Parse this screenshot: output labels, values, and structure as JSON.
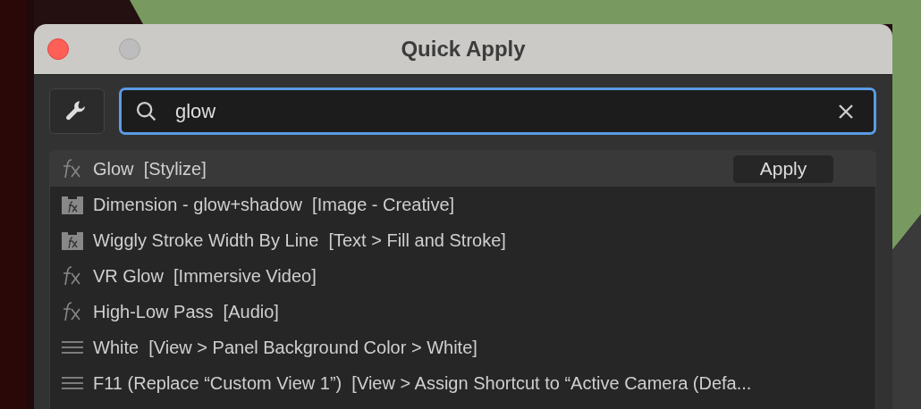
{
  "window": {
    "title": "Quick Apply"
  },
  "search": {
    "value": "glow"
  },
  "results": [
    {
      "kind": "effect",
      "label": "Glow  [Stylize]",
      "selected": true,
      "action": "Apply"
    },
    {
      "kind": "preset",
      "label": "Dimension - glow+shadow  [Image - Creative]",
      "selected": false
    },
    {
      "kind": "preset",
      "label": "Wiggly Stroke Width By Line  [Text > Fill and Stroke]",
      "selected": false
    },
    {
      "kind": "effect",
      "label": "VR Glow  [Immersive Video]",
      "selected": false
    },
    {
      "kind": "effect",
      "label": "High-Low Pass  [Audio]",
      "selected": false
    },
    {
      "kind": "menu",
      "label": "White  [View > Panel Background Color > White]",
      "selected": false
    },
    {
      "kind": "menu",
      "label": "F11 (Replace “Custom View 1”)  [View > Assign Shortcut to “Active Camera (Defa...",
      "selected": false
    }
  ]
}
